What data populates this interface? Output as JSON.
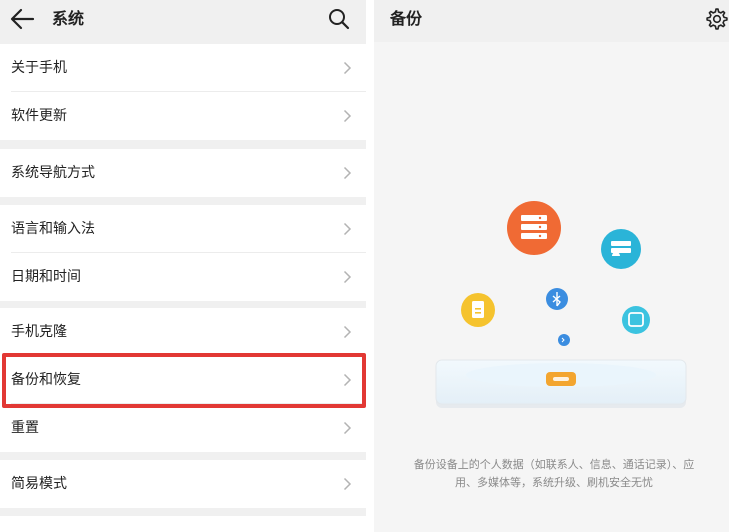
{
  "settings": {
    "back_icon": "arrow-left-icon",
    "title": "系统",
    "search_icon": "search-icon",
    "groups": [
      {
        "items": [
          {
            "label": "关于手机"
          },
          {
            "label": "软件更新"
          }
        ]
      },
      {
        "items": [
          {
            "label": "系统导航方式"
          }
        ]
      },
      {
        "items": [
          {
            "label": "语言和输入法"
          },
          {
            "label": "日期和时间"
          }
        ]
      },
      {
        "items": [
          {
            "label": "手机克隆"
          },
          {
            "label": "备份和恢复"
          },
          {
            "label": "重置"
          }
        ]
      },
      {
        "items": [
          {
            "label": "简易模式"
          }
        ]
      }
    ],
    "highlighted_item": "备份和恢复",
    "highlight_color": "#e23834"
  },
  "backup": {
    "title": "备份",
    "settings_icon": "gear-icon",
    "description": "备份设备上的个人数据（如联系人、信息、通话记录）、应用、多媒体等，系统升级、刷机安全无忧",
    "illustration_colors": {
      "orange": "#f06a34",
      "teal": "#2ab4d8",
      "yellow": "#f5c32e",
      "blue": "#3b8de0",
      "cyan": "#3bc3e0"
    }
  }
}
